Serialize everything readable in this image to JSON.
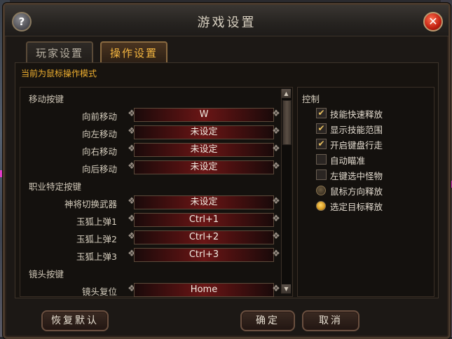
{
  "window": {
    "title": "游戏设置",
    "help_label": "?",
    "close_label": "✕"
  },
  "tabs": [
    {
      "label": "玩家设置",
      "active": false
    },
    {
      "label": "操作设置",
      "active": true
    }
  ],
  "mode_text": "当前为鼠标操作模式",
  "keybinds": {
    "sections": [
      "移动按键",
      "职业特定按键",
      "镜头按键"
    ],
    "rows": [
      {
        "label": "向前移动",
        "value": "W"
      },
      {
        "label": "向左移动",
        "value": "未设定"
      },
      {
        "label": "向右移动",
        "value": "未设定"
      },
      {
        "label": "向后移动",
        "value": "未设定"
      },
      {
        "label": "神将切换武器",
        "value": "未设定"
      },
      {
        "label": "玉狐上弹1",
        "value": "Ctrl+1"
      },
      {
        "label": "玉狐上弹2",
        "value": "Ctrl+2"
      },
      {
        "label": "玉狐上弹3",
        "value": "Ctrl+3"
      },
      {
        "label": "镜头复位",
        "value": "Home"
      }
    ]
  },
  "control": {
    "title": "控制",
    "checkboxes": [
      {
        "label": "技能快速释放",
        "checked": true
      },
      {
        "label": "显示技能范围",
        "checked": true
      },
      {
        "label": "开启键盘行走",
        "checked": true
      },
      {
        "label": "自动瞄准",
        "checked": false
      },
      {
        "label": "左键选中怪物",
        "checked": false
      }
    ],
    "radios": [
      {
        "label": "鼠标方向释放",
        "selected": false
      },
      {
        "label": "选定目标释放",
        "selected": true
      }
    ]
  },
  "buttons": {
    "restore_default": "恢复默认",
    "confirm": "确定",
    "cancel": "取消"
  },
  "icons": {
    "check": "✔",
    "ornament_left": "❖",
    "ornament_right": "❖",
    "scroll_up": "▲",
    "scroll_down": "▼"
  }
}
